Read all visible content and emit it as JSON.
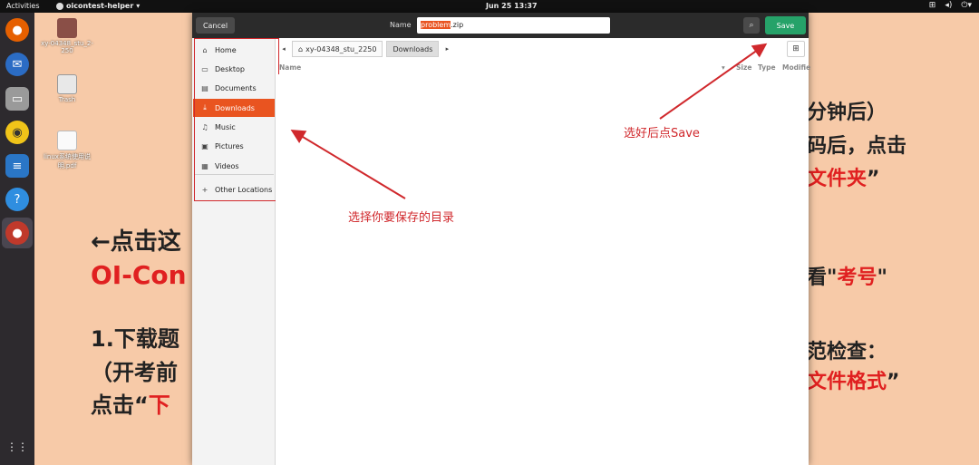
{
  "topbar": {
    "activities": "Activities",
    "app_name": "oicontest-helper",
    "clock": "Jun 25  13:37",
    "tray": [
      "network-icon",
      "volume-icon",
      "power-icon"
    ]
  },
  "dock": {
    "items": [
      "firefox-icon",
      "thunderbird-icon",
      "files-icon",
      "rhythmbox-icon",
      "writer-icon",
      "help-icon",
      "oicontest-icon",
      "apps-grid-icon"
    ]
  },
  "desktop_icons": [
    {
      "label": "xy-04348_stu_2-250",
      "icon": "folder-icon"
    },
    {
      "label": "Trash",
      "icon": "trash-icon"
    },
    {
      "label": "linux系统使用说明.pdf",
      "icon": "pdf-icon"
    }
  ],
  "wallpaper_text": {
    "left1": "←点击这",
    "left2": "OI-Con",
    "left3": "1.下载题",
    "left4": "（开考前",
    "left5_a": "点击“",
    "left5_b": "下",
    "right1": "分钟后）",
    "right2": "码后，点击",
    "right3": "文件夹",
    "right3_q": "”",
    "right4_a": "看\"",
    "right4_b": "考号",
    "right4_c": "\"",
    "right5": "范检查：",
    "right6": "文件格式",
    "right6_q": "”"
  },
  "dialog": {
    "cancel_label": "Cancel",
    "name_label": "Name",
    "filename_selected": "problem",
    "filename_rest": ".zip",
    "save_label": "Save",
    "sidebar": [
      {
        "label": "Home",
        "icon": "home-icon"
      },
      {
        "label": "Desktop",
        "icon": "desktop-icon"
      },
      {
        "label": "Documents",
        "icon": "documents-icon"
      },
      {
        "label": "Downloads",
        "icon": "downloads-icon",
        "active": true
      },
      {
        "label": "Music",
        "icon": "music-icon"
      },
      {
        "label": "Pictures",
        "icon": "pictures-icon"
      },
      {
        "label": "Videos",
        "icon": "videos-icon"
      },
      {
        "label": "Other Locations",
        "icon": "plus-icon"
      }
    ],
    "path": [
      "xy-04348_stu_2250",
      "Downloads"
    ],
    "columns": [
      "Name",
      "Size",
      "Type",
      "Modifie"
    ]
  },
  "annotations": {
    "directory_hint": "选择你要保存的目录",
    "save_hint": "选好后点Save"
  },
  "colors": {
    "accent": "#e95420",
    "save_green": "#26a269",
    "annotation_red": "#d0282c"
  }
}
